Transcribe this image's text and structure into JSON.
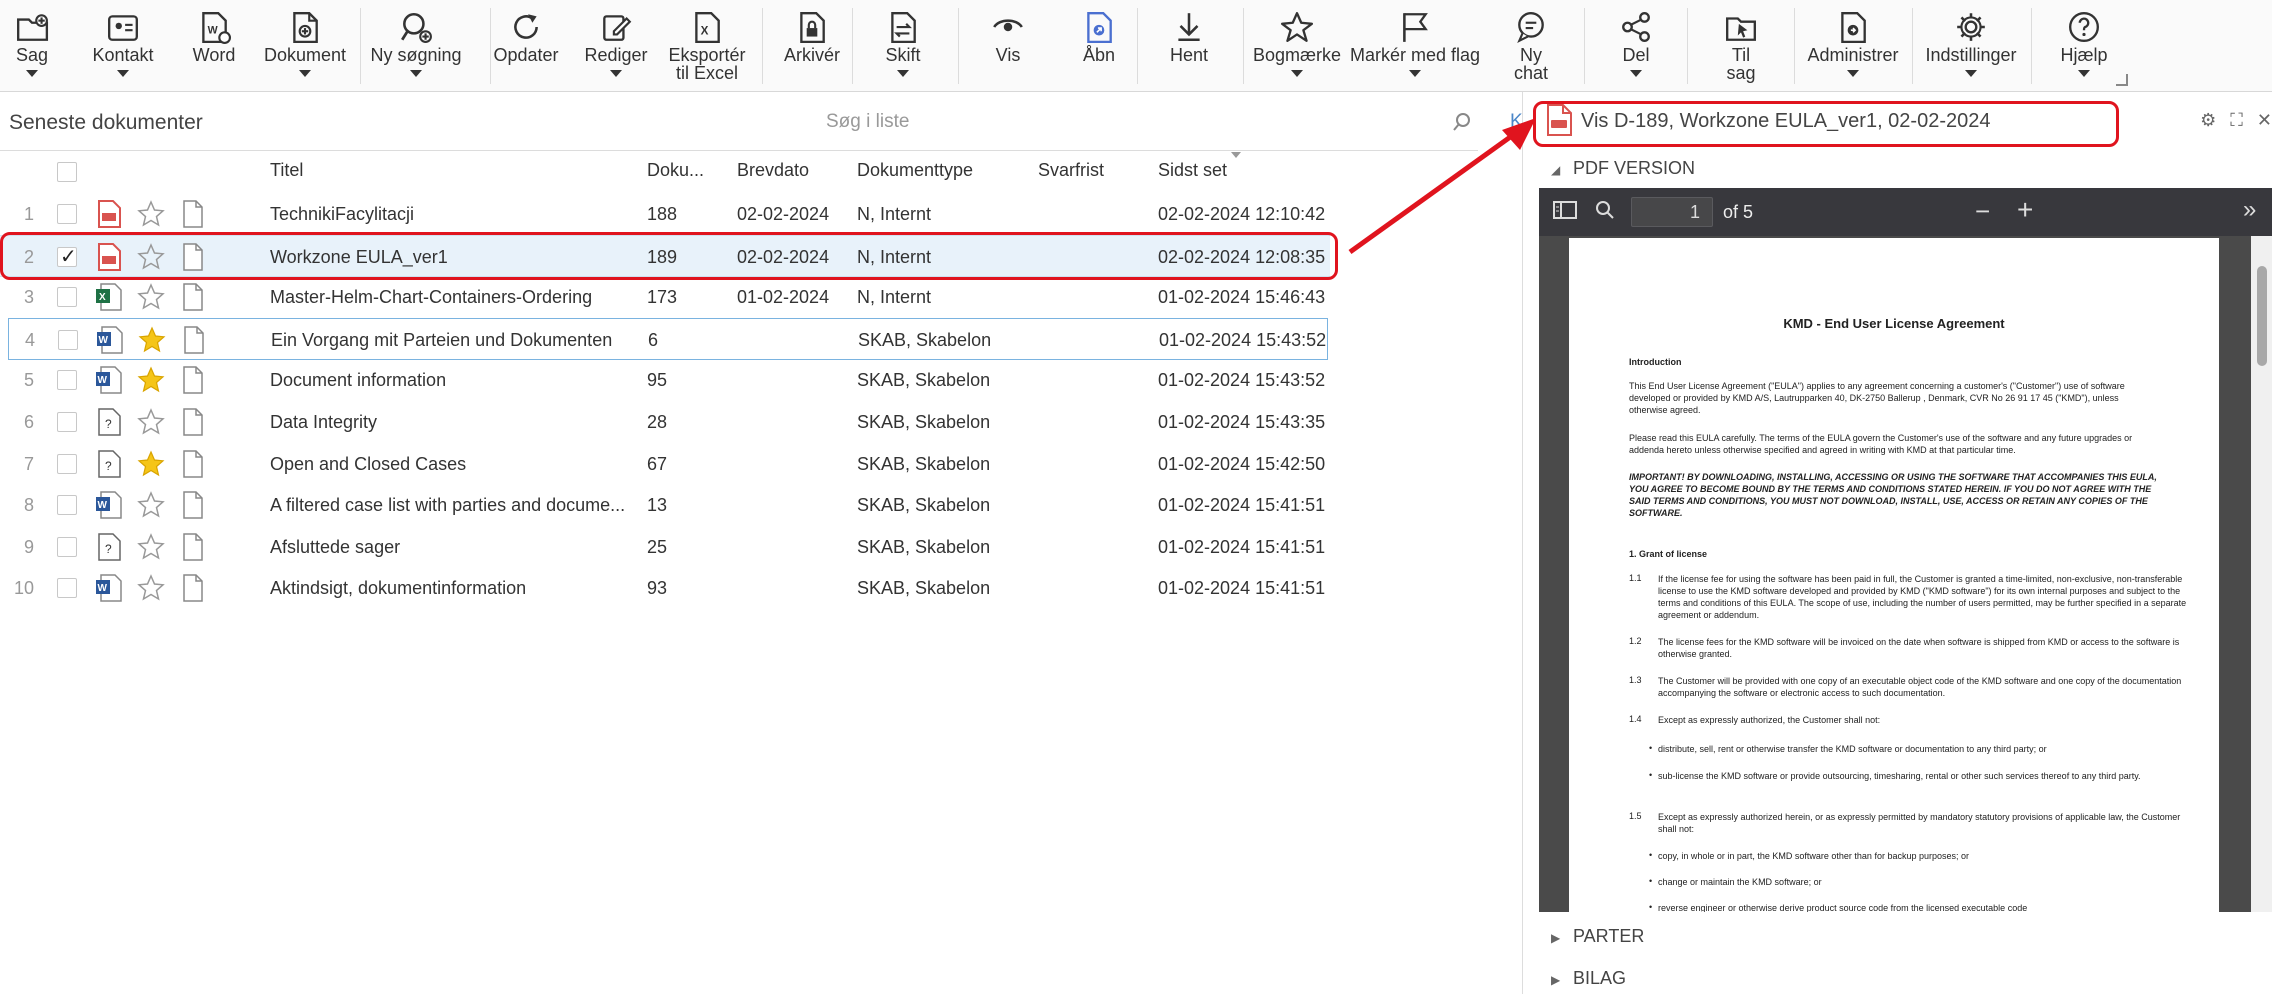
{
  "toolbar": {
    "buttons": [
      {
        "label": "Sag",
        "icon": "folder-plus-icon",
        "caret": true
      },
      {
        "label": "Kontakt",
        "icon": "contact-card-icon",
        "caret": true
      },
      {
        "label": "Word",
        "icon": "word-doc-icon",
        "caret": false
      },
      {
        "label": "Dokument",
        "icon": "document-plus-icon",
        "caret": true
      },
      {
        "label": "Ny søgning",
        "icon": "search-plus-icon",
        "caret": true
      },
      {
        "label": "Opdater",
        "icon": "refresh-icon",
        "caret": false
      },
      {
        "label": "Rediger",
        "icon": "edit-icon",
        "caret": true
      },
      {
        "label": "Eksportér\ntil Excel",
        "icon": "excel-export-icon",
        "caret": false
      },
      {
        "label": "Arkivér",
        "icon": "archive-lock-icon",
        "caret": false
      },
      {
        "label": "Skift",
        "icon": "switch-doc-icon",
        "caret": true
      },
      {
        "label": "Vis",
        "icon": "eye-icon",
        "caret": false
      },
      {
        "label": "Åbn",
        "icon": "open-doc-icon",
        "caret": false
      },
      {
        "label": "Hent",
        "icon": "download-icon",
        "caret": false
      },
      {
        "label": "Bogmærke",
        "icon": "star-icon",
        "caret": true
      },
      {
        "label": "Markér med flag",
        "icon": "flag-icon",
        "caret": true
      },
      {
        "label": "Ny\nchat",
        "icon": "chat-icon",
        "caret": false
      },
      {
        "label": "Del",
        "icon": "share-icon",
        "caret": true
      },
      {
        "label": "Til\nsag",
        "icon": "move-to-case-icon",
        "caret": false
      },
      {
        "label": "Administrer",
        "icon": "manage-doc-icon",
        "caret": true
      },
      {
        "label": "Indstillinger",
        "icon": "gear-icon",
        "caret": true
      },
      {
        "label": "Hjælp",
        "icon": "help-icon",
        "caret": true
      }
    ]
  },
  "list": {
    "title": "Seneste dokumenter",
    "search_placeholder": "Søg i liste",
    "cut_text": "K",
    "columns": [
      "Titel",
      "Doku...",
      "Brevdato",
      "Dokumenttype",
      "Svarfrist",
      "Sidst set"
    ],
    "rows": [
      {
        "n": "1",
        "ftype": "pdf",
        "star": false,
        "checked": false,
        "title": "TechnikiFacylitacji",
        "doc": "188",
        "date": "02-02-2024",
        "type": "N, Internt",
        "due": "",
        "seen": "02-02-2024 12:10:42"
      },
      {
        "n": "2",
        "ftype": "pdf",
        "star": false,
        "checked": true,
        "title": "Workzone EULA_ver1",
        "doc": "189",
        "date": "02-02-2024",
        "type": "N, Internt",
        "due": "",
        "seen": "02-02-2024 12:08:35"
      },
      {
        "n": "3",
        "ftype": "excel",
        "star": false,
        "checked": false,
        "title": "Master-Helm-Chart-Containers-Ordering",
        "doc": "173",
        "date": "01-02-2024",
        "type": "N, Internt",
        "due": "",
        "seen": "01-02-2024 15:46:43"
      },
      {
        "n": "4",
        "ftype": "word",
        "star": true,
        "checked": false,
        "title": "Ein Vorgang mit Parteien und Dokumenten",
        "doc": "6",
        "date": "",
        "type": "SKAB, Skabelon",
        "due": "",
        "seen": "01-02-2024 15:43:52"
      },
      {
        "n": "5",
        "ftype": "word",
        "star": true,
        "checked": false,
        "title": "Document information",
        "doc": "95",
        "date": "",
        "type": "SKAB, Skabelon",
        "due": "",
        "seen": "01-02-2024 15:43:52"
      },
      {
        "n": "6",
        "ftype": "unknown",
        "star": false,
        "checked": false,
        "title": "Data Integrity",
        "doc": "28",
        "date": "",
        "type": "SKAB, Skabelon",
        "due": "",
        "seen": "01-02-2024 15:43:35"
      },
      {
        "n": "7",
        "ftype": "unknown",
        "star": true,
        "checked": false,
        "title": "Open and Closed Cases",
        "doc": "67",
        "date": "",
        "type": "SKAB, Skabelon",
        "due": "",
        "seen": "01-02-2024 15:42:50"
      },
      {
        "n": "8",
        "ftype": "word",
        "star": false,
        "checked": false,
        "title": "A filtered case list with parties and docume...",
        "doc": "13",
        "date": "",
        "type": "SKAB, Skabelon",
        "due": "",
        "seen": "01-02-2024 15:41:51"
      },
      {
        "n": "9",
        "ftype": "unknown",
        "star": false,
        "checked": false,
        "title": "Afsluttede sager",
        "doc": "25",
        "date": "",
        "type": "SKAB, Skabelon",
        "due": "",
        "seen": "01-02-2024 15:41:51"
      },
      {
        "n": "10",
        "ftype": "word",
        "star": false,
        "checked": false,
        "title": "Aktindsigt, dokumentinformation",
        "doc": "93",
        "date": "",
        "type": "SKAB, Skabelon",
        "due": "",
        "seen": "01-02-2024 15:41:51"
      }
    ]
  },
  "panel": {
    "title": "Vis D-189, Workzone EULA_ver1, 02-02-2024",
    "section_pdf": "PDF VERSION",
    "section_parter": "PARTER",
    "section_bilag": "BILAG",
    "viewer": {
      "page": "1",
      "of": "of 5"
    },
    "pdf": {
      "heading": "KMD - End User License Agreement",
      "intro_h": "Introduction",
      "p1": "This End User License Agreement (\"EULA\") applies to any agreement concerning a customer's (\"Customer\") use of software developed or provided by KMD A/S, Lautrupparken 40, DK-2750 Ballerup , Denmark, CVR No 26 91 17 45 (\"KMD\"), unless otherwise agreed.",
      "p2": "Please read this EULA carefully. The terms of the EULA govern the Customer's use of the software and any future upgrades or addenda hereto unless otherwise specified and agreed in writing with KMD at that particular time.",
      "p3": "IMPORTANT! BY DOWNLOADING, INSTALLING, ACCESSING OR USING THE SOFTWARE THAT ACCOMPANIES THIS EULA, YOU AGREE TO BECOME BOUND BY THE TERMS AND CONDITIONS STATED HEREIN. IF YOU DO NOT AGREE WITH THE SAID TERMS AND CONDITIONS, YOU MUST NOT DOWNLOAD, INSTALL, USE, ACCESS OR RETAIN ANY COPIES OF THE SOFTWARE.",
      "s1": "1.   Grant of license",
      "c11n": "1.1",
      "c11": "If the license fee for using the software has been paid in full, the Customer is granted a time-limited, non-exclusive, non-transferable license to use the KMD software developed and provided by KMD (\"KMD software\") for its own internal purposes and subject to the terms and conditions of this EULA. The scope of use, including the number of users permitted, may be further specified in a separate agreement or addendum.",
      "c12n": "1.2",
      "c12": "The license fees for the KMD software will be invoiced on the date when software is shipped from KMD or access to the software is otherwise granted.",
      "c13n": "1.3",
      "c13": "The Customer will be provided with one copy of an executable object code of the KMD software and one copy of the documentation accompanying the software or electronic access to such documentation.",
      "c14n": "1.4",
      "c14": "Except as expressly authorized, the Customer shall not:",
      "b1": "distribute, sell, rent or otherwise transfer the KMD software or documentation to any third party; or",
      "b2": "sub-license the KMD software or provide outsourcing, timesharing, rental or other such services thereof to any third party.",
      "c15n": "1.5",
      "c15": "Except as expressly authorized herein, or as expressly permitted by mandatory statutory provisions of applicable law, the Customer shall not:",
      "b3": "copy, in whole or in part, the KMD software other than for backup purposes; or",
      "b4": "change or maintain the KMD software; or",
      "b5": "reverse engineer or otherwise derive product source code from the licensed executable code"
    }
  },
  "colors": {
    "accent": "#2b579a",
    "annotation": "#e0141e",
    "star": "#f5c518",
    "pdf": "#d9534f",
    "excel": "#1e7145"
  }
}
